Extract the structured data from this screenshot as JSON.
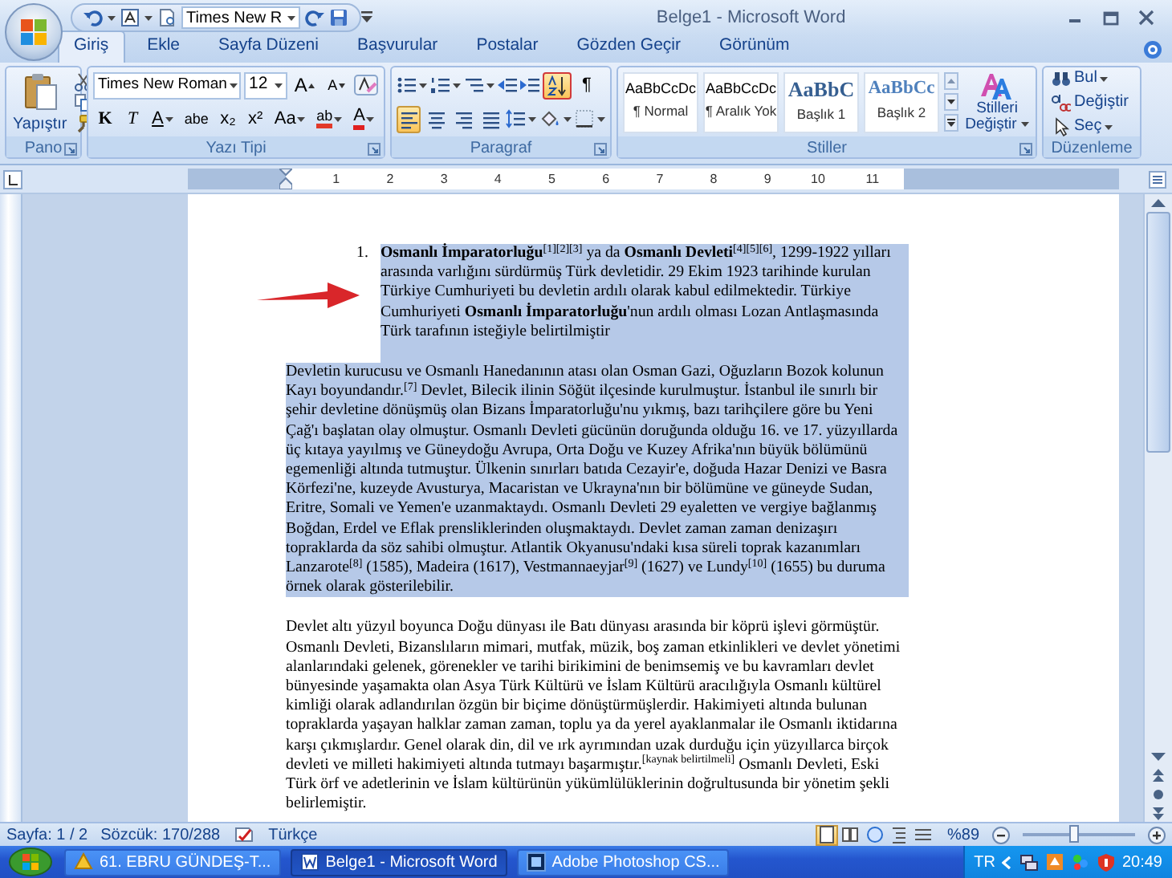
{
  "window": {
    "title": "Belge1 - Microsoft Word"
  },
  "quick_access": {
    "font_field": "Times New R"
  },
  "tabs": [
    {
      "label": "Giriş",
      "selected": true
    },
    {
      "label": "Ekle",
      "selected": false
    },
    {
      "label": "Sayfa Düzeni",
      "selected": false
    },
    {
      "label": "Başvurular",
      "selected": false
    },
    {
      "label": "Postalar",
      "selected": false
    },
    {
      "label": "Gözden Geçir",
      "selected": false
    },
    {
      "label": "Görünüm",
      "selected": false
    }
  ],
  "ribbon": {
    "clipboard": {
      "paste_label": "Yapıştır",
      "label": "Pano"
    },
    "font": {
      "font_name": "Times New Roman",
      "number_field": "12",
      "size_buttons": [
        {
          "label": "A",
          "kind": "grow"
        },
        {
          "label": "A",
          "kind": "shrink"
        }
      ],
      "format_buttons": [
        {
          "label": "K",
          "kind": "bold"
        },
        {
          "label": "T",
          "kind": "italic"
        },
        {
          "label": "A",
          "kind": "underline"
        },
        {
          "label": "abe",
          "kind": "strike"
        },
        {
          "label": "x₂",
          "kind": "subscript"
        },
        {
          "label": "x²",
          "kind": "superscript"
        },
        {
          "label": "Aa",
          "kind": "case"
        },
        {
          "label": "ab",
          "kind": "highlight"
        },
        {
          "label": "A",
          "kind": "color"
        }
      ],
      "label": "Yazı Tipi"
    },
    "paragraph": {
      "alignment": [
        {
          "kind": "left",
          "selected": true
        },
        {
          "kind": "center",
          "selected": false
        },
        {
          "kind": "right",
          "selected": false
        },
        {
          "kind": "justify",
          "selected": false
        }
      ],
      "sort": {
        "on": true
      },
      "show_marks": {
        "label": "¶",
        "on": false
      },
      "label": "Paragraf"
    },
    "styles": {
      "items": [
        {
          "sample": "AaBbCcDc",
          "name": "¶ Normal",
          "kind": "body"
        },
        {
          "sample": "AaBbCcDc",
          "name": "¶ Aralık Yok",
          "kind": "body"
        },
        {
          "sample": "AaBbC",
          "name": "Başlık 1",
          "kind": "heading1"
        },
        {
          "sample": "AaBbCc",
          "name": "Başlık 2",
          "kind": "heading2"
        }
      ],
      "change_button": "Stilleri Değiştir",
      "label": "Stiller"
    },
    "editing": {
      "items": [
        {
          "label": "Bul",
          "kind": "find",
          "dropdown": true
        },
        {
          "label": "Değiştir",
          "kind": "replace",
          "dropdown": false
        },
        {
          "label": "Seç",
          "kind": "select",
          "dropdown": true
        }
      ],
      "label": "Düzenleme"
    }
  },
  "ruler": {
    "numbers": [
      "1",
      "2",
      "3",
      "4",
      "5",
      "6",
      "7",
      "8",
      "9",
      "10",
      "11"
    ]
  },
  "document": {
    "blocks": [
      {
        "kind": "list_item",
        "number": "1.",
        "selected": true,
        "text": "**Osmanlı İmparatorluğu**$^{[1][2][3]}$ ya da **Osmanlı Devleti**$^{[4][5][6]}$, 1299-1922 yılları arasında varlığını sürdürmüş Türk devletidir. 29 Ekim 1923 tarihinde kurulan Türkiye Cumhuriyeti bu devletin ardılı olarak kabul edilmektedir. Türkiye Cumhuriyeti **Osmanlı İmparatorluğu**'nun ardılı olması Lozan Antlaşmasında Türk tarafının isteğiyle belirtilmiştir"
      },
      {
        "kind": "paragraph",
        "selected": true,
        "text": "Devletin kurucusu ve Osmanlı Hanedanının atası olan Osman Gazi, Oğuzların Bozok kolunun Kayı boyundandır.$^{[7]}$ Devlet, Bilecik ilinin Söğüt ilçesinde kurulmuştur. İstanbul ile sınırlı bir şehir devletine dönüşmüş olan Bizans İmparatorluğu'nu yıkmış, bazı tarihçilere göre bu Yeni Çağ'ı başlatan olay olmuştur. Osmanlı Devleti gücünün doruğunda olduğu 16. ve 17. yüzyıllarda üç kıtaya yayılmış ve Güneydoğu Avrupa, Orta Doğu ve Kuzey Afrika'nın büyük bölümünü egemenliği altında tutmuştur. Ülkenin sınırları batıda Cezayir'e, doğuda Hazar Denizi ve Basra Körfezi'ne, kuzeyde Avusturya, Macaristan ve Ukrayna'nın bir bölümüne ve güneyde Sudan, Eritre, Somali ve Yemen'e uzanmaktaydı. Osmanlı Devleti 29 eyaletten ve vergiye bağlanmış Boğdan, Erdel ve Eflak prensliklerinden oluşmaktaydı. Devlet zaman zaman denizaşırı topraklarda da söz sahibi olmuştur. Atlantik Okyanusu'ndaki kısa süreli toprak kazanımları Lanzarote$^{[8]}$ (1585), Madeira (1617), Vestmannaeyjar$^{[9]}$ (1627) ve Lundy$^{[10]}$ (1655) bu duruma örnek olarak gösterilebilir."
      },
      {
        "kind": "paragraph",
        "selected": false,
        "text": "Devlet altı yüzyıl boyunca Doğu dünyası ile Batı dünyası arasında bir köprü işlevi görmüştür. Osmanlı Devleti, Bizanslıların mimari, mutfak, müzik, boş zaman etkinlikleri ve devlet yönetimi alanlarındaki gelenek, görenekler ve tarihi birikimini de benimsemiş ve bu kavramları devlet bünyesinde yaşamakta olan Asya Türk Kültürü ve İslam Kültürü aracılığıyla Osmanlı kültürel kimliği olarak adlandırılan özgün bir biçime dönüştürmüşlerdir. Hakimiyeti altında bulunan topraklarda yaşayan halklar zaman zaman, toplu ya da yerel ayaklanmalar ile Osmanlı iktidarına karşı çıkmışlardır. Genel olarak din, dil ve ırk ayrımından uzak durduğu için yüzyıllarca birçok devleti ve milleti hakimiyeti altında tutmayı başarmıştır.$^{[kaynak belirtilmeli]}$ Osmanlı Devleti, Eski Türk örf ve adetlerinin ve İslam kültürünün yükümlülüklerinin doğrultusunda bir yönetim şekli belirlemiştir."
      }
    ]
  },
  "status_bar": {
    "page": "Sayfa: 1 / 2",
    "words": "Sözcük: 170/288",
    "language": "Türkçe",
    "views": [
      {
        "kind": "print",
        "selected": true
      },
      {
        "kind": "reading",
        "selected": false
      },
      {
        "kind": "web",
        "selected": false
      },
      {
        "kind": "outline",
        "selected": false
      },
      {
        "kind": "draft",
        "selected": false
      }
    ],
    "zoom": "%89",
    "zoom_slider": {
      "level": 0.45
    }
  },
  "taskbar": {
    "items": [
      {
        "label": "61. EBRU GÜNDEŞ-T...",
        "kind": "media",
        "selected": false
      },
      {
        "label": "Belge1 - Microsoft Word",
        "kind": "word",
        "selected": true
      },
      {
        "label": "Adobe Photoshop CS...",
        "kind": "photoshop",
        "selected": false
      }
    ],
    "language": "TR",
    "clock": "20:49"
  }
}
